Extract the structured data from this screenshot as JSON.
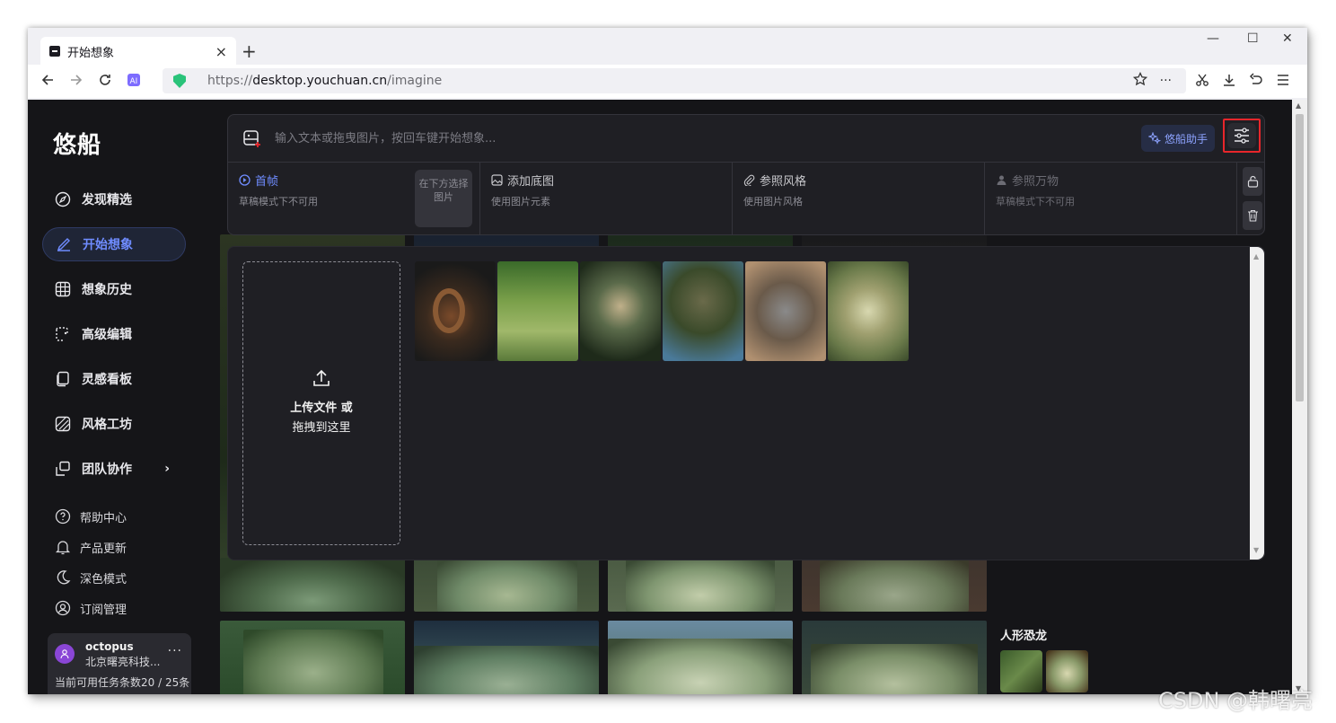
{
  "browser": {
    "tab_title": "开始想象",
    "tab_close": "×",
    "new_tab": "+",
    "url_scheme": "https://",
    "url_host": "desktop.youchuan.cn",
    "url_path": "/imagine",
    "win_minimize": "—",
    "win_maximize": "☐",
    "win_close": "✕"
  },
  "sidebar": {
    "logo": "悠船",
    "items": [
      {
        "label": "发现精选",
        "icon": "compass-icon"
      },
      {
        "label": "开始想象",
        "icon": "brush-icon",
        "active": true
      },
      {
        "label": "想象历史",
        "icon": "grid-icon"
      },
      {
        "label": "高级编辑",
        "icon": "edit-icon"
      },
      {
        "label": "灵感看板",
        "icon": "board-icon"
      },
      {
        "label": "风格工坊",
        "icon": "style-icon"
      },
      {
        "label": "团队协作",
        "icon": "team-icon",
        "has_arrow": true,
        "arrow": "›"
      }
    ],
    "sub_items": [
      {
        "label": "帮助中心",
        "icon": "help-icon"
      },
      {
        "label": "产品更新",
        "icon": "bell-icon"
      },
      {
        "label": "深色模式",
        "icon": "moon-icon"
      },
      {
        "label": "订阅管理",
        "icon": "user-circle-icon"
      }
    ],
    "user": {
      "name": "octopus",
      "org": "北京曙亮科技...",
      "more": "···",
      "quota": "当前可用任务条数20 / 25条"
    }
  },
  "prompt": {
    "placeholder": "输入文本或拖曳图片，按回车键开始想象...",
    "assistant_label": "悠船助手",
    "refs": [
      {
        "title": "首帧",
        "sub": "草稿模式下不可用",
        "accent": "#6f8cff",
        "icon": "play-circle-icon"
      },
      {
        "title": "添加底图",
        "sub": "使用图片元素",
        "accent": "#c8c8cc",
        "icon": "image-icon"
      },
      {
        "title": "参照风格",
        "sub": "使用图片风格",
        "accent": "#c8c8cc",
        "icon": "paperclip-icon"
      },
      {
        "title": "参照万物",
        "sub": "草稿模式下不可用",
        "accent": "#6c6c74",
        "icon": "person-icon"
      }
    ],
    "pick_button": "在下方选择图片"
  },
  "upload": {
    "line1": "上传文件 或",
    "line2": "拖拽到这里"
  },
  "right_column": {
    "label": "人形恐龙"
  },
  "watermark": "CSDN @韩曙亮",
  "colors": {
    "accent": "#6f8cff",
    "highlight": "#e8262b",
    "bg": "#151518",
    "panel": "#1f1f24"
  }
}
